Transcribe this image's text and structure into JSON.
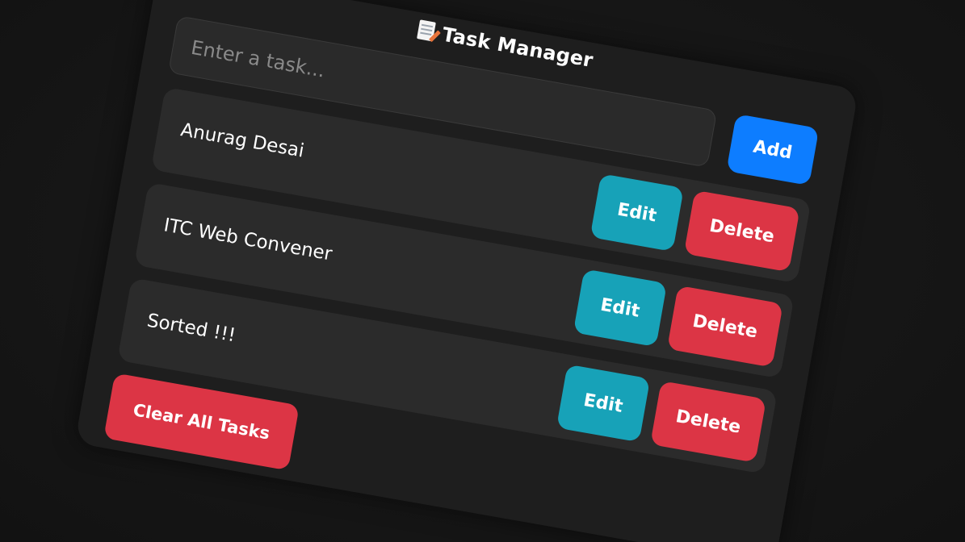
{
  "header": {
    "title": "Task Manager",
    "title_icon": "memo-icon"
  },
  "input": {
    "placeholder": "Enter a task...",
    "value": ""
  },
  "buttons": {
    "add_label": "Add",
    "clear_label": "Clear All Tasks"
  },
  "tasks": [
    {
      "text": "Anurag Desai",
      "edit_label": "Edit",
      "delete_label": "Delete"
    },
    {
      "text": "ITC Web Convener",
      "edit_label": "Edit",
      "delete_label": "Delete"
    },
    {
      "text": "Sorted !!!",
      "edit_label": "Edit",
      "delete_label": "Delete"
    }
  ],
  "colors": {
    "background": "#161616",
    "card": "#1e1e1e",
    "task_item": "#2b2b2b",
    "add": "#0d7dff",
    "edit": "#17a2b8",
    "delete": "#dc3545"
  }
}
